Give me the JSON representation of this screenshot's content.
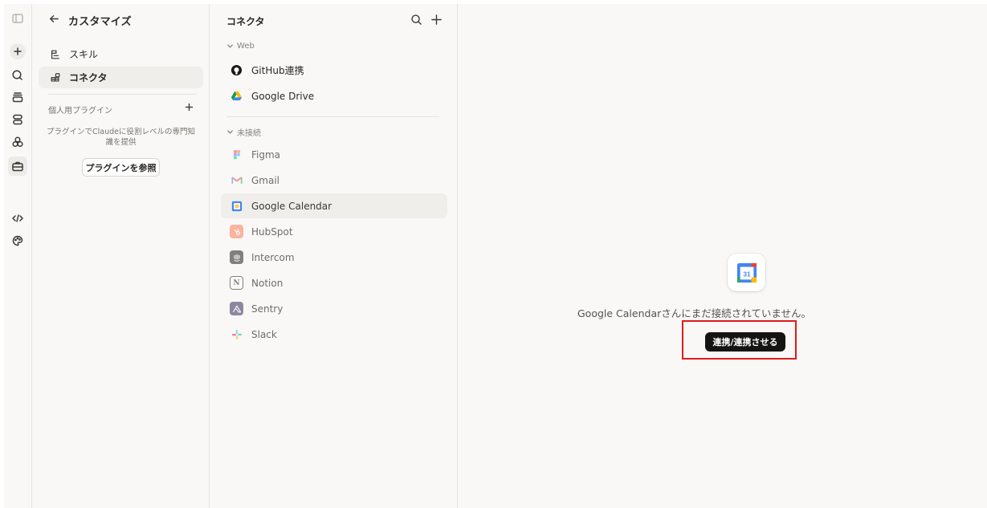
{
  "rail": {
    "icons": [
      "sidebar-toggle-icon",
      "new-chat-icon",
      "chats-icon",
      "projects-icon",
      "artifacts-icon",
      "agents-icon",
      "customize-icon",
      "code-icon",
      "palette-icon"
    ]
  },
  "customize": {
    "back_icon": "arrow-left-icon",
    "title": "カスタマイズ",
    "nav": [
      {
        "label": "スキル",
        "icon": "skills-icon"
      },
      {
        "label": "コネクタ",
        "icon": "connectors-icon",
        "active": true
      }
    ],
    "plugins_heading": "個人用プラグイン",
    "plugins_description": "プラグインでClaudeに役割レベルの専門知識を提供",
    "browse_plugins_label": "プラグインを参照"
  },
  "connectors": {
    "title": "コネクタ",
    "web_section": "Web",
    "web_items": [
      {
        "name": "GitHub連携",
        "icon": "github-icon"
      },
      {
        "name": "Google Drive",
        "icon": "google-drive-icon"
      }
    ],
    "not_connected_section": "未接続",
    "not_connected_items": [
      {
        "name": "Figma",
        "icon": "figma-icon"
      },
      {
        "name": "Gmail",
        "icon": "gmail-icon"
      },
      {
        "name": "Google Calendar",
        "icon": "google-calendar-icon",
        "active": true
      },
      {
        "name": "HubSpot",
        "icon": "hubspot-icon"
      },
      {
        "name": "Intercom",
        "icon": "intercom-icon"
      },
      {
        "name": "Notion",
        "icon": "notion-icon"
      },
      {
        "name": "Sentry",
        "icon": "sentry-icon"
      },
      {
        "name": "Slack",
        "icon": "slack-icon"
      }
    ]
  },
  "detail": {
    "calendar_day": "31",
    "message": "Google Calendarさんにまだ接続されていません。",
    "connect_label": "連携/連携させる"
  },
  "colors": {
    "background": "#f9f8f6",
    "active_item": "#efeeea",
    "button_dark": "#141413",
    "highlight": "#e01b1b"
  }
}
